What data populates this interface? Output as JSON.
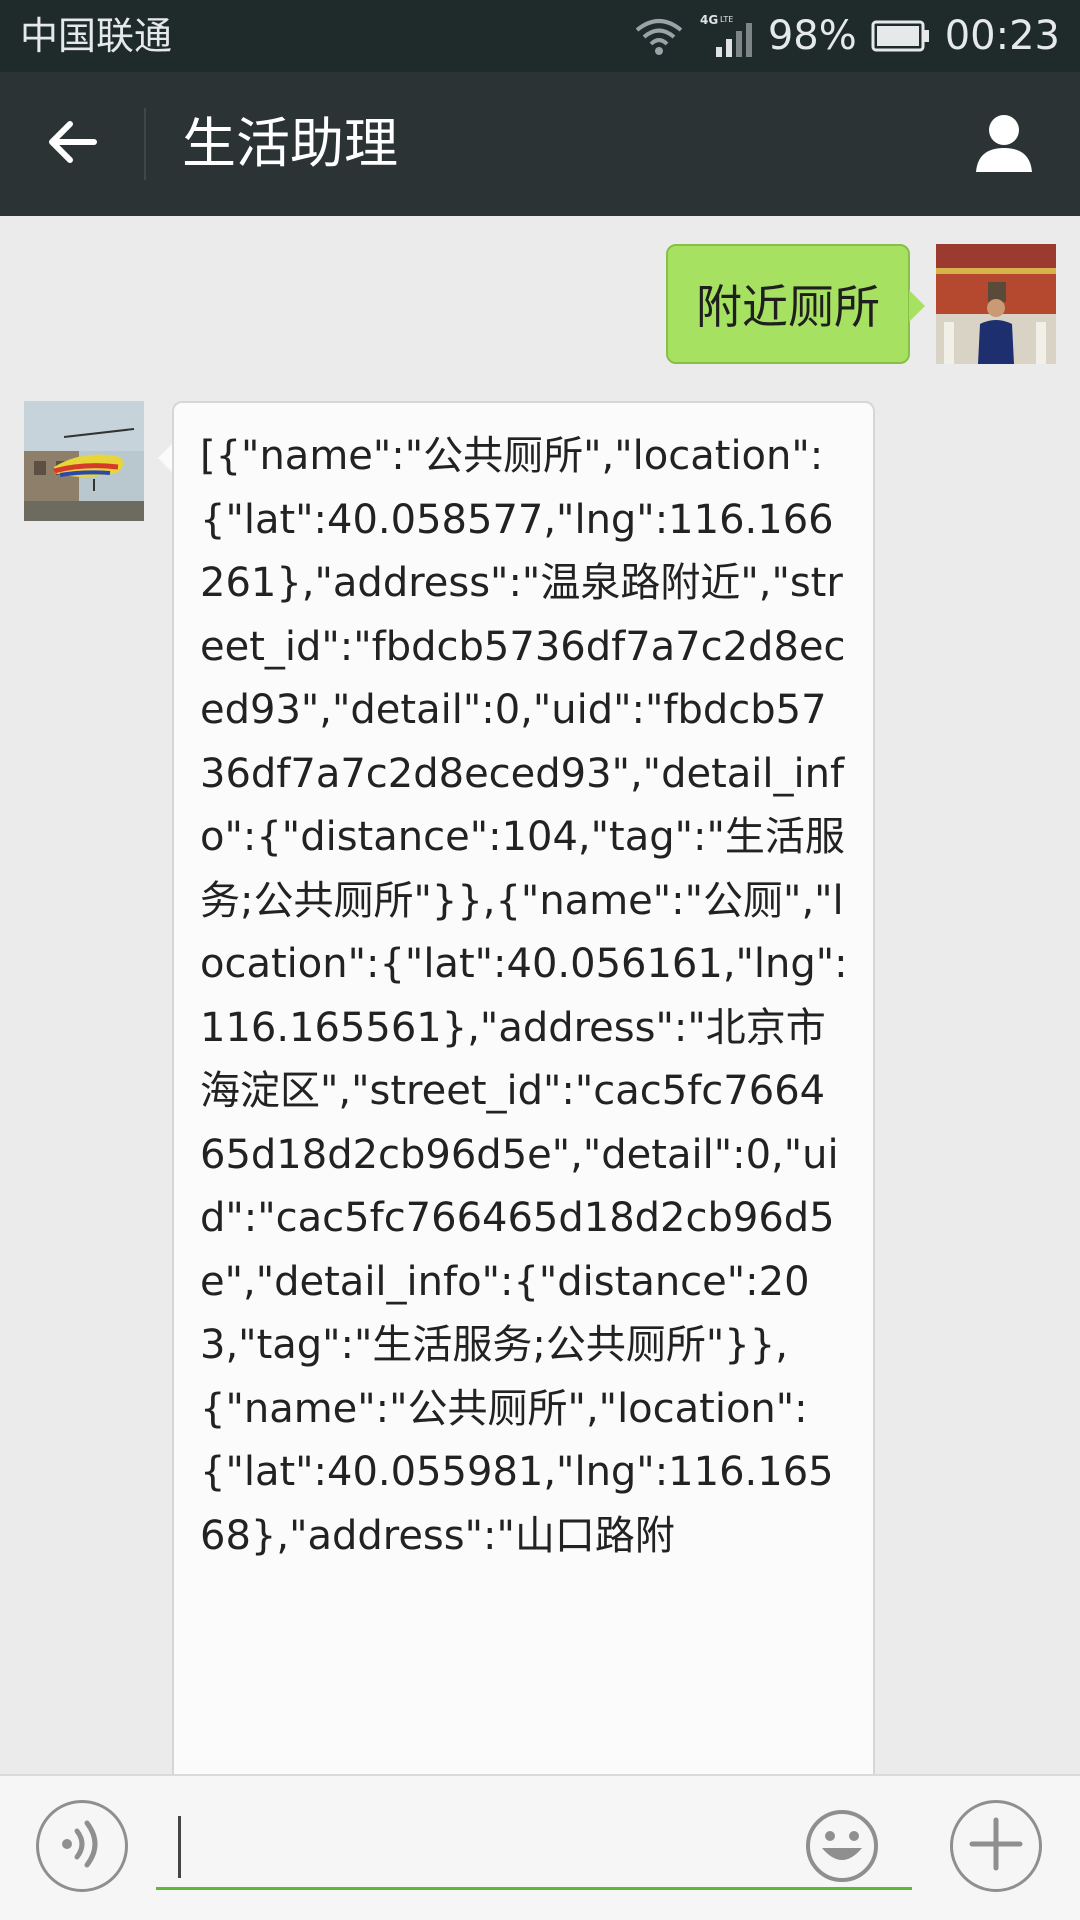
{
  "status_bar": {
    "carrier": "中国联通",
    "network": "4G LTE",
    "battery": "98%",
    "time": "00:23"
  },
  "header": {
    "title": "生活助理"
  },
  "messages": {
    "sent": "附近厕所",
    "received": "[{\"name\":\"公共厕所\",\"location\":{\"lat\":40.058577,\"lng\":116.166261},\"address\":\"温泉路附近\",\"street_id\":\"fbdcb5736df7a7c2d8eced93\",\"detail\":0,\"uid\":\"fbdcb5736df7a7c2d8eced93\",\"detail_info\":{\"distance\":104,\"tag\":\"生活服务;公共厕所\"}},{\"name\":\"公厕\",\"location\":{\"lat\":40.056161,\"lng\":116.165561},\"address\":\"北京市海淀区\",\"street_id\":\"cac5fc766465d18d2cb96d5e\",\"detail\":0,\"uid\":\"cac5fc766465d18d2cb96d5e\",\"detail_info\":{\"distance\":203,\"tag\":\"生活服务;公共厕所\"}},{\"name\":\"公共厕所\",\"location\":{\"lat\":40.055981,\"lng\":116.16568},\"address\":\"山口路附"
  },
  "input": {
    "value": ""
  },
  "colors": {
    "status_bar_bg": "#1f2a2b",
    "header_bg": "#2b3335",
    "chat_bg": "#ebebeb",
    "sent_bubble": "#a6e161",
    "received_bubble": "#fbfbfb",
    "input_underline": "#5fb837"
  },
  "icons": [
    "wifi-icon",
    "signal-icon",
    "battery-icon",
    "back-arrow-icon",
    "person-icon",
    "voice-icon",
    "emoji-icon",
    "plus-icon"
  ]
}
